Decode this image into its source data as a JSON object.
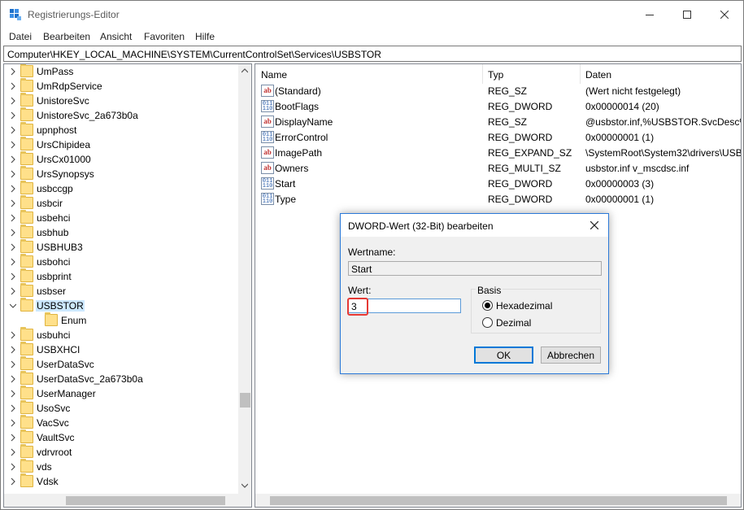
{
  "window": {
    "title": "Registrierungs-Editor"
  },
  "menu": [
    "Datei",
    "Bearbeiten",
    "Ansicht",
    "Favoriten",
    "Hilfe"
  ],
  "address": "Computer\\HKEY_LOCAL_MACHINE\\SYSTEM\\CurrentControlSet\\Services\\USBSTOR",
  "tree": {
    "items": [
      {
        "label": "UmPass",
        "expandable": true
      },
      {
        "label": "UmRdpService",
        "expandable": true
      },
      {
        "label": "UnistoreSvc",
        "expandable": true
      },
      {
        "label": "UnistoreSvc_2a673b0a",
        "expandable": true
      },
      {
        "label": "upnphost",
        "expandable": true
      },
      {
        "label": "UrsChipidea",
        "expandable": true
      },
      {
        "label": "UrsCx01000",
        "expandable": true
      },
      {
        "label": "UrsSynopsys",
        "expandable": true
      },
      {
        "label": "usbccgp",
        "expandable": true
      },
      {
        "label": "usbcir",
        "expandable": true
      },
      {
        "label": "usbehci",
        "expandable": true
      },
      {
        "label": "usbhub",
        "expandable": true
      },
      {
        "label": "USBHUB3",
        "expandable": true
      },
      {
        "label": "usbohci",
        "expandable": true
      },
      {
        "label": "usbprint",
        "expandable": true
      },
      {
        "label": "usbser",
        "expandable": true
      },
      {
        "label": "USBSTOR",
        "expandable": true,
        "expanded": true,
        "selected": true
      },
      {
        "label": "Enum",
        "expandable": false,
        "child": true
      },
      {
        "label": "usbuhci",
        "expandable": true
      },
      {
        "label": "USBXHCI",
        "expandable": true
      },
      {
        "label": "UserDataSvc",
        "expandable": true
      },
      {
        "label": "UserDataSvc_2a673b0a",
        "expandable": true
      },
      {
        "label": "UserManager",
        "expandable": true
      },
      {
        "label": "UsoSvc",
        "expandable": true
      },
      {
        "label": "VacSvc",
        "expandable": true
      },
      {
        "label": "VaultSvc",
        "expandable": true
      },
      {
        "label": "vdrvroot",
        "expandable": true
      },
      {
        "label": "vds",
        "expandable": true
      },
      {
        "label": "Vdsk",
        "expandable": true
      }
    ]
  },
  "values": {
    "headers": {
      "name": "Name",
      "type": "Typ",
      "data": "Daten"
    },
    "rows": [
      {
        "icon": "string-value-icon",
        "name": "(Standard)",
        "type": "REG_SZ",
        "data": "(Wert nicht festgelegt)"
      },
      {
        "icon": "binary-value-icon",
        "name": "BootFlags",
        "type": "REG_DWORD",
        "data": "0x00000014 (20)"
      },
      {
        "icon": "string-value-icon",
        "name": "DisplayName",
        "type": "REG_SZ",
        "data": "@usbstor.inf,%USBSTOR.SvcDesc%;"
      },
      {
        "icon": "binary-value-icon",
        "name": "ErrorControl",
        "type": "REG_DWORD",
        "data": "0x00000001 (1)"
      },
      {
        "icon": "string-value-icon",
        "name": "ImagePath",
        "type": "REG_EXPAND_SZ",
        "data": "\\SystemRoot\\System32\\drivers\\USB"
      },
      {
        "icon": "string-value-icon",
        "name": "Owners",
        "type": "REG_MULTI_SZ",
        "data": "usbstor.inf v_mscdsc.inf"
      },
      {
        "icon": "binary-value-icon",
        "name": "Start",
        "type": "REG_DWORD",
        "data": "0x00000003 (3)"
      },
      {
        "icon": "binary-value-icon",
        "name": "Type",
        "type": "REG_DWORD",
        "data": "0x00000001 (1)"
      }
    ]
  },
  "dialog": {
    "title": "DWORD-Wert (32-Bit) bearbeiten",
    "name_label": "Wertname:",
    "name_value": "Start",
    "value_label": "Wert:",
    "value": "3",
    "base_label": "Basis",
    "hex_label": "Hexadezimal",
    "dec_label": "Dezimal",
    "selected_base": "Hexadezimal",
    "ok_label": "OK",
    "cancel_label": "Abbrechen"
  },
  "colors": {
    "selection": "#cce8ff",
    "accent": "#0078d7",
    "highlight": "#e53935",
    "folder": "#ffe08a"
  }
}
